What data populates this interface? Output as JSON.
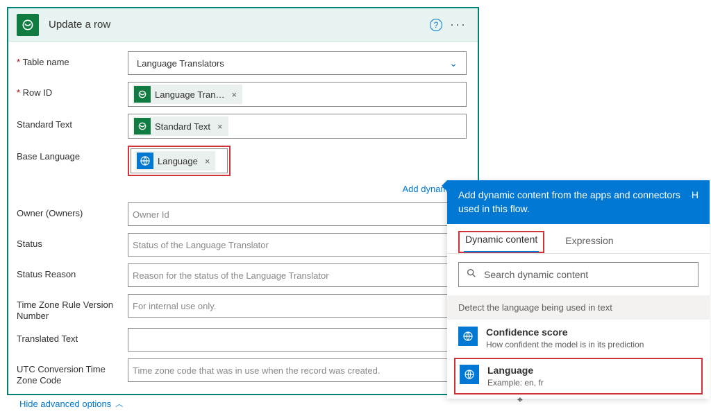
{
  "card": {
    "title": "Update a row",
    "table_name_label": "Table name",
    "table_name_value": "Language Translators",
    "row_id_label": "Row ID",
    "row_id_token": "Language Tran…",
    "std_text_label": "Standard Text",
    "std_text_token": "Standard Text",
    "base_lang_label": "Base Language",
    "base_lang_token": "Language",
    "add_dynamic": "Add dynamic co",
    "owner_label": "Owner (Owners)",
    "owner_ph": "Owner Id",
    "status_label": "Status",
    "status_ph": "Status of the Language Translator",
    "status_reason_label": "Status Reason",
    "status_reason_ph": "Reason for the status of the Language Translator",
    "tz_rule_label": "Time Zone Rule Version Number",
    "tz_rule_ph": "For internal use only.",
    "translated_label": "Translated Text",
    "utc_label": "UTC Conversion Time Zone Code",
    "utc_ph": "Time zone code that was in use when the record was created.",
    "hide_adv": "Hide advanced options"
  },
  "panel": {
    "head_text": "Add dynamic content from the apps and connectors used in this flow.",
    "hide": "H",
    "tab_dc": "Dynamic content",
    "tab_expr": "Expression",
    "search_ph": "Search dynamic content",
    "group": "Detect the language being used in text",
    "items": [
      {
        "title": "Confidence score",
        "sub": "How confident the model is in its prediction"
      },
      {
        "title": "Language",
        "sub": "Example: en, fr"
      }
    ]
  }
}
